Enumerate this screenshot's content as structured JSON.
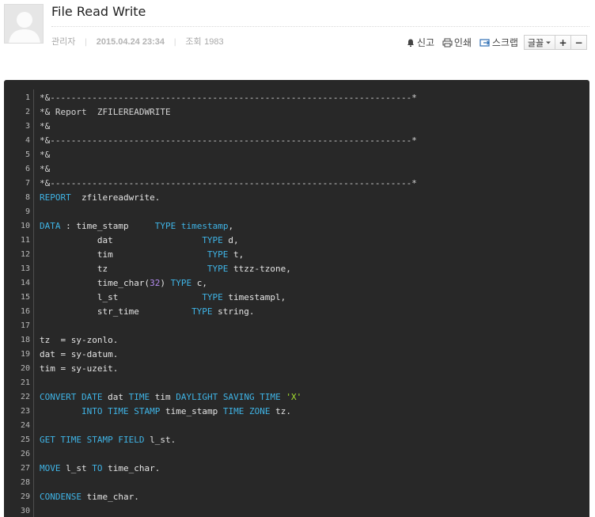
{
  "post": {
    "title": "File Read Write",
    "author": "관리자",
    "date": "2015.04.24 23:34",
    "views_label": "조회",
    "views_count": "1983"
  },
  "actions": {
    "report": "신고",
    "print": "인쇄",
    "scrap": "스크랩"
  },
  "font_control": {
    "label": "글꼴",
    "increase": "+",
    "decrease": "−"
  },
  "icons": [
    "avatar-placeholder-icon",
    "bell-icon",
    "printer-icon",
    "scrap-icon",
    "dropdown-arrow-icon"
  ],
  "colors": {
    "code_bg": "#282828",
    "keyword": "#3fb4e6",
    "number": "#b48cf0",
    "string": "#a6e22e",
    "code_text": "#e4e4e4",
    "line_number": "#b9b9b9"
  },
  "code": {
    "line_numbers": [
      "1",
      "2",
      "3",
      "4",
      "5",
      "6",
      "7",
      "8",
      "9",
      "10",
      "11",
      "12",
      "13",
      "14",
      "15",
      "16",
      "17",
      "18",
      "19",
      "20",
      "21",
      "22",
      "23",
      "24",
      "25",
      "26",
      "27",
      "28",
      "29",
      "30"
    ],
    "lines": [
      [
        [
          "*&---------------------------------------------------------------------*",
          "cm"
        ]
      ],
      [
        [
          "*& Report  ZFILEREADWRITE",
          "cm"
        ]
      ],
      [
        [
          "*&",
          "cm"
        ]
      ],
      [
        [
          "*&---------------------------------------------------------------------*",
          "cm"
        ]
      ],
      [
        [
          "*&",
          "cm"
        ]
      ],
      [
        [
          "*&",
          "cm"
        ]
      ],
      [
        [
          "*&---------------------------------------------------------------------*",
          "cm"
        ]
      ],
      [
        [
          "REPORT",
          "kw"
        ],
        [
          "  zfilereadwrite.",
          ""
        ]
      ],
      [],
      [
        [
          "DATA",
          "kw"
        ],
        [
          " : time_stamp     ",
          ""
        ],
        [
          "TYPE",
          "kw"
        ],
        [
          " ",
          ""
        ],
        [
          "timestamp",
          "kw"
        ],
        [
          ",",
          ""
        ]
      ],
      [
        [
          "           dat                 ",
          ""
        ],
        [
          "TYPE",
          "kw"
        ],
        [
          " d,",
          ""
        ]
      ],
      [
        [
          "           tim                  ",
          ""
        ],
        [
          "TYPE",
          "kw"
        ],
        [
          " t,",
          ""
        ]
      ],
      [
        [
          "           tz                   ",
          ""
        ],
        [
          "TYPE",
          "kw"
        ],
        [
          " ttzz-tzone,",
          ""
        ]
      ],
      [
        [
          "           time_char(",
          ""
        ],
        [
          "32",
          "num"
        ],
        [
          ") ",
          ""
        ],
        [
          "TYPE",
          "kw"
        ],
        [
          " c,",
          ""
        ]
      ],
      [
        [
          "           l_st                ",
          ""
        ],
        [
          "TYPE",
          "kw"
        ],
        [
          " timestampl,",
          ""
        ]
      ],
      [
        [
          "           str_time          ",
          ""
        ],
        [
          "TYPE",
          "kw"
        ],
        [
          " string.",
          ""
        ]
      ],
      [],
      [
        [
          "tz  = sy-zonlo.",
          ""
        ]
      ],
      [
        [
          "dat = sy-datum.",
          ""
        ]
      ],
      [
        [
          "tim = sy-uzeit.",
          ""
        ]
      ],
      [],
      [
        [
          "CONVERT",
          "kw"
        ],
        [
          " ",
          ""
        ],
        [
          "DATE",
          "kw"
        ],
        [
          " dat ",
          ""
        ],
        [
          "TIME",
          "kw"
        ],
        [
          " tim ",
          ""
        ],
        [
          "DAYLIGHT",
          "kw"
        ],
        [
          " ",
          ""
        ],
        [
          "SAVING",
          "kw"
        ],
        [
          " ",
          ""
        ],
        [
          "TIME",
          "kw"
        ],
        [
          " ",
          ""
        ],
        [
          "'X'",
          "str"
        ]
      ],
      [
        [
          "        ",
          ""
        ],
        [
          "INTO",
          "kw"
        ],
        [
          " ",
          ""
        ],
        [
          "TIME",
          "kw"
        ],
        [
          " ",
          ""
        ],
        [
          "STAMP",
          "kw"
        ],
        [
          " time_stamp ",
          ""
        ],
        [
          "TIME",
          "kw"
        ],
        [
          " ",
          ""
        ],
        [
          "ZONE",
          "kw"
        ],
        [
          " tz.",
          ""
        ]
      ],
      [],
      [
        [
          "GET",
          "kw"
        ],
        [
          " ",
          ""
        ],
        [
          "TIME",
          "kw"
        ],
        [
          " ",
          ""
        ],
        [
          "STAMP",
          "kw"
        ],
        [
          " ",
          ""
        ],
        [
          "FIELD",
          "kw"
        ],
        [
          " l_st.",
          ""
        ]
      ],
      [],
      [
        [
          "MOVE",
          "kw"
        ],
        [
          " l_st ",
          ""
        ],
        [
          "TO",
          "kw"
        ],
        [
          " time_char.",
          ""
        ]
      ],
      [],
      [
        [
          "CONDENSE",
          "kw"
        ],
        [
          " time_char.",
          ""
        ]
      ],
      []
    ]
  }
}
